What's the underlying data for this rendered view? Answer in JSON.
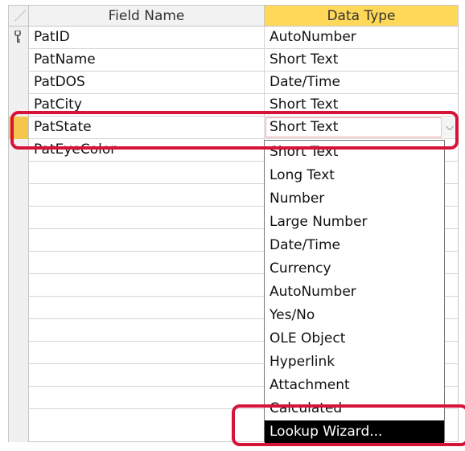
{
  "header": {
    "field_name": "Field Name",
    "data_type": "Data Type"
  },
  "rows": [
    {
      "field": "PatID",
      "type": "AutoNumber"
    },
    {
      "field": "PatName",
      "type": "Short Text"
    },
    {
      "field": "PatDOS",
      "type": "Date/Time"
    },
    {
      "field": "PatCity",
      "type": "Short Text"
    },
    {
      "field": "PatState",
      "type": "Short Text"
    },
    {
      "field": "PatEyeColor",
      "type": ""
    },
    {
      "field": "",
      "type": ""
    },
    {
      "field": "",
      "type": ""
    },
    {
      "field": "",
      "type": ""
    },
    {
      "field": "",
      "type": ""
    },
    {
      "field": "",
      "type": ""
    },
    {
      "field": "",
      "type": ""
    },
    {
      "field": "",
      "type": ""
    },
    {
      "field": "",
      "type": ""
    },
    {
      "field": "",
      "type": ""
    },
    {
      "field": "",
      "type": ""
    },
    {
      "field": "",
      "type": ""
    },
    {
      "field": "",
      "type": ""
    }
  ],
  "dropdown": {
    "options": [
      "Short Text",
      "Long Text",
      "Number",
      "Large Number",
      "Date/Time",
      "Currency",
      "AutoNumber",
      "Yes/No",
      "OLE Object",
      "Hyperlink",
      "Attachment",
      "Calculated",
      "Lookup Wizard..."
    ],
    "highlighted": "Lookup Wizard..."
  },
  "colors": {
    "header_accent": "#ffd85a",
    "annotation": "#d6143a",
    "highlight": "#000000"
  },
  "icons": {
    "primary_key": "key-icon",
    "dropdown_arrow": "chevron-down-icon"
  }
}
